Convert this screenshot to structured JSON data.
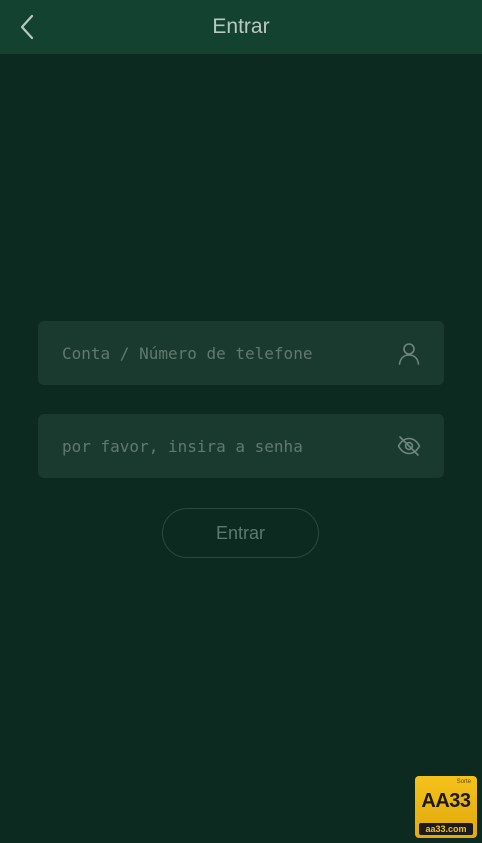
{
  "header": {
    "title": "Entrar",
    "back_icon": "chevron-left-icon"
  },
  "form": {
    "account": {
      "placeholder": "Conta / Número de telefone",
      "value": "",
      "icon": "user-icon"
    },
    "password": {
      "placeholder": "por favor, insira a senha",
      "value": "",
      "icon": "eye-slash-icon"
    },
    "submit_label": "Entrar"
  },
  "badge": {
    "top_text": "Sorte",
    "main_text": "AA33",
    "url_text": "aa33.com"
  },
  "colors": {
    "background": "#0c2a1f",
    "header": "#134231",
    "field": "#1b3a2f",
    "badge": "#f5c21b"
  }
}
